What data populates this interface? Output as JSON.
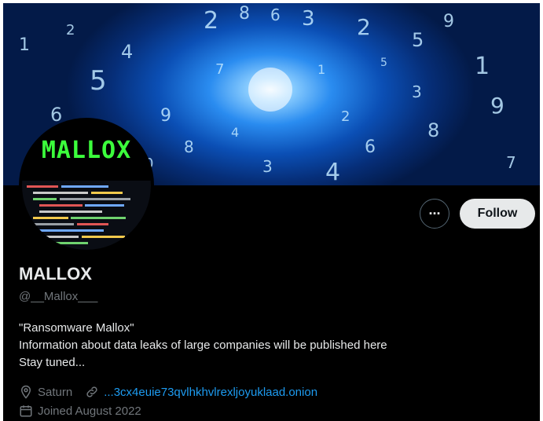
{
  "header": {
    "avatar_logo_text": "MALLOX",
    "accent": "#1d9bf0",
    "logo_color": "#3cff3c"
  },
  "actions": {
    "more_label": "···",
    "follow_label": "Follow"
  },
  "profile": {
    "display_name": "MALLOX",
    "handle": "@__Mallox___",
    "bio": [
      "\"Ransomware Mallox\"",
      "Information about data leaks of large companies will be published here",
      "Stay tuned..."
    ],
    "location": "Saturn",
    "website": "...3cx4euie73qvlhkhvlrexljoyuklaad.onion",
    "joined": "Joined August 2022"
  },
  "icons": {
    "location": "location-pin-icon",
    "link": "link-icon",
    "calendar": "calendar-icon"
  }
}
